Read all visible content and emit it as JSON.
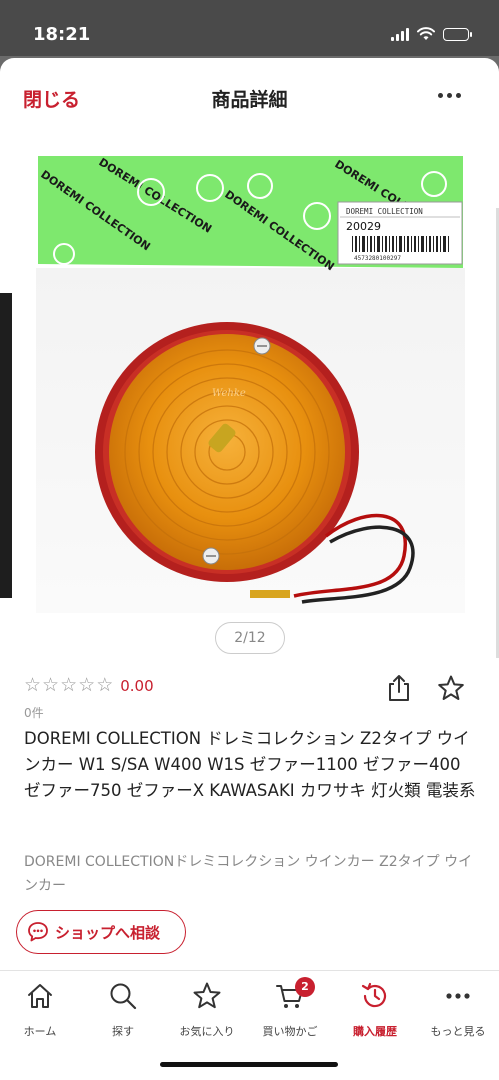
{
  "status_bar": {
    "time": "18:21"
  },
  "header": {
    "close_label": "閉じる",
    "title": "商品詳細"
  },
  "product_image": {
    "header_brand": "DOREMI COLLECTION",
    "label_brand": "DOREMI COLLECTION",
    "label_code": "20029",
    "label_barcode_number": "4573280100297",
    "lens_marking": "Wehke"
  },
  "pager": {
    "text": "2/12"
  },
  "rating": {
    "value": "0.00",
    "count_label": "0件",
    "stars_filled": 0,
    "stars_total": 5
  },
  "product": {
    "title": "DOREMI COLLECTION ドレミコレクション Z2タイプ ウインカー W1 S/SA W400 W1S ゼファー1100 ゼファー400 ゼファー750 ゼファーX KAWASAKI カワサキ 灯火類 電装系",
    "subtitle": "DOREMI COLLECTIONドレミコレクション ウインカー Z2タイプ ウインカー"
  },
  "shop_button": {
    "label": "ショップへ相談"
  },
  "bottom_nav": {
    "home": "ホーム",
    "search": "探す",
    "favorites": "お気に入り",
    "cart": "買い物かご",
    "cart_badge": "2",
    "history": "購入履歴",
    "more": "もっと見る"
  },
  "colors": {
    "accent": "#c8202f",
    "package_green": "#7ee86e",
    "lens_orange": "#e8900f"
  },
  "icons": [
    "signal-icon",
    "wifi-icon",
    "battery-icon",
    "more-icon",
    "star-icon",
    "share-icon",
    "favorite-icon",
    "chat-icon",
    "home-icon",
    "search-icon",
    "cart-icon",
    "history-icon"
  ]
}
